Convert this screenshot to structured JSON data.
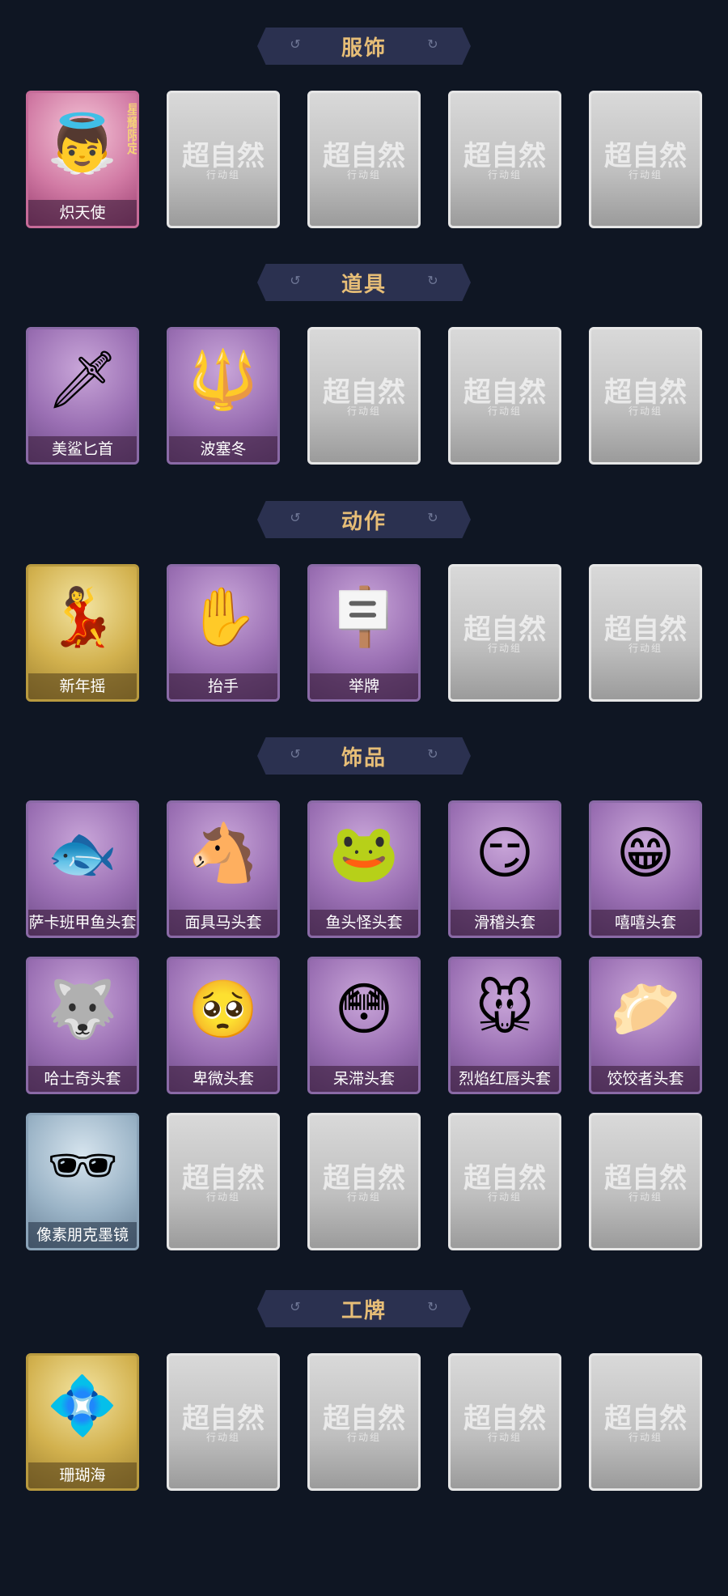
{
  "locked_card": {
    "main_text": "超自然",
    "sub_text": "行动组"
  },
  "sections": [
    {
      "title": "服饰",
      "items": [
        {
          "label": "炽天使",
          "tier": "pink",
          "icon": "angel-portrait-icon",
          "glyph": "👼",
          "badge": "星耀限定"
        },
        {
          "label": "",
          "tier": "locked"
        },
        {
          "label": "",
          "tier": "locked"
        },
        {
          "label": "",
          "tier": "locked"
        },
        {
          "label": "",
          "tier": "locked"
        }
      ]
    },
    {
      "title": "道具",
      "items": [
        {
          "label": "美鲨匕首",
          "tier": "purple",
          "icon": "dagger-icon",
          "glyph": "🗡"
        },
        {
          "label": "波塞冬",
          "tier": "purple",
          "icon": "trident-icon",
          "glyph": "🔱"
        },
        {
          "label": "",
          "tier": "locked"
        },
        {
          "label": "",
          "tier": "locked"
        },
        {
          "label": "",
          "tier": "locked"
        }
      ]
    },
    {
      "title": "动作",
      "items": [
        {
          "label": "新年摇",
          "tier": "gold",
          "icon": "dance-icon",
          "glyph": "💃"
        },
        {
          "label": "抬手",
          "tier": "purple",
          "icon": "raise-hand-icon",
          "glyph": "✋"
        },
        {
          "label": "举牌",
          "tier": "purple",
          "icon": "sign-board-icon",
          "glyph": "🪧"
        },
        {
          "label": "",
          "tier": "locked"
        },
        {
          "label": "",
          "tier": "locked"
        }
      ]
    },
    {
      "title": "饰品",
      "items": [
        {
          "label": "萨卡班甲鱼头套",
          "tier": "purple",
          "icon": "fish-head-icon",
          "glyph": "🐟"
        },
        {
          "label": "面具马头套",
          "tier": "purple",
          "icon": "horse-head-icon",
          "glyph": "🐴"
        },
        {
          "label": "鱼头怪头套",
          "tier": "purple",
          "icon": "fish-monster-head-icon",
          "glyph": "🐸"
        },
        {
          "label": "滑稽头套",
          "tier": "purple",
          "icon": "smirk-face-icon",
          "glyph": "😏"
        },
        {
          "label": "嘻嘻头套",
          "tier": "purple",
          "icon": "grin-face-icon",
          "glyph": "😁"
        },
        {
          "label": "哈士奇头套",
          "tier": "purple",
          "icon": "husky-head-icon",
          "glyph": "🐺"
        },
        {
          "label": "卑微头套",
          "tier": "purple",
          "icon": "pleading-face-icon",
          "glyph": "🥺"
        },
        {
          "label": "呆滞头套",
          "tier": "purple",
          "icon": "dazed-face-icon",
          "glyph": "😳"
        },
        {
          "label": "烈焰红唇头套",
          "tier": "purple",
          "icon": "pikachu-head-icon",
          "glyph": "🐭"
        },
        {
          "label": "饺饺者头套",
          "tier": "purple",
          "icon": "dumpling-head-icon",
          "glyph": "🥟"
        },
        {
          "label": "像素朋克墨镜",
          "tier": "blue",
          "icon": "pixel-sunglasses-icon",
          "glyph": "🕶"
        },
        {
          "label": "",
          "tier": "locked"
        },
        {
          "label": "",
          "tier": "locked"
        },
        {
          "label": "",
          "tier": "locked"
        },
        {
          "label": "",
          "tier": "locked"
        }
      ]
    },
    {
      "title": "工牌",
      "items": [
        {
          "label": "珊瑚海",
          "tier": "gold",
          "icon": "badge-card-icon",
          "glyph": "💠"
        },
        {
          "label": "",
          "tier": "locked"
        },
        {
          "label": "",
          "tier": "locked"
        },
        {
          "label": "",
          "tier": "locked"
        },
        {
          "label": "",
          "tier": "locked"
        }
      ]
    }
  ]
}
